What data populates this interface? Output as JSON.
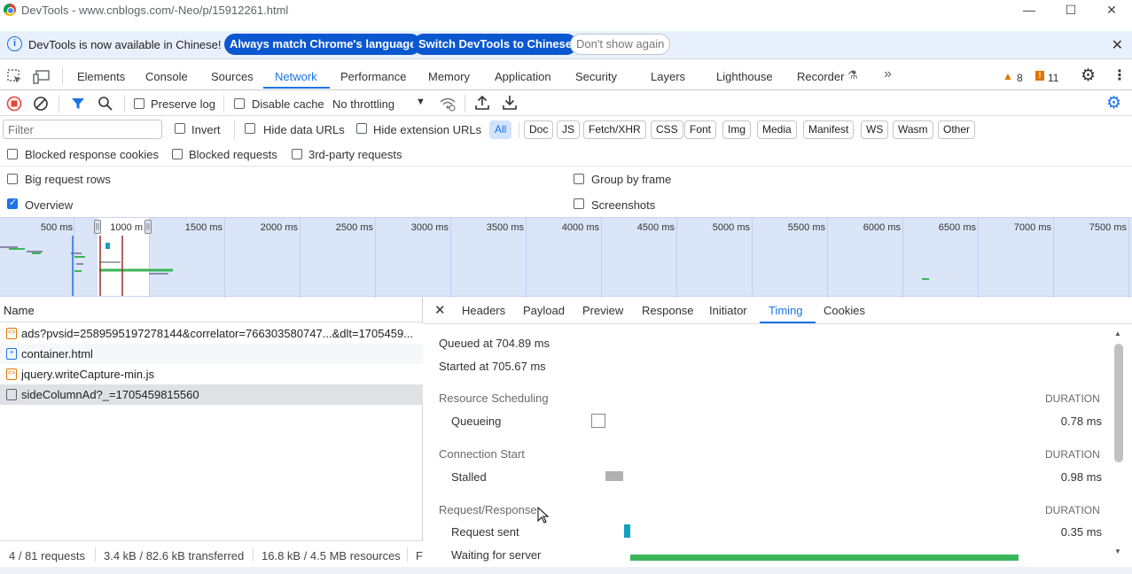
{
  "window": {
    "title": "DevTools - www.cnblogs.com/-Neo/p/15912261.html",
    "minimize": "—",
    "maximize": "☐",
    "close": "✕"
  },
  "infobar": {
    "message": "DevTools is now available in Chinese!",
    "btn_match": "Always match Chrome's language",
    "btn_switch": "Switch DevTools to Chinese",
    "btn_dismiss": "Don't show again",
    "close": "✕"
  },
  "main_tabs": [
    "Elements",
    "Console",
    "Sources",
    "Network",
    "Performance",
    "Memory",
    "Application",
    "Security",
    "Layers",
    "Lighthouse",
    "Recorder"
  ],
  "active_tab": "Network",
  "badges": {
    "warnings": "8",
    "issues": "11"
  },
  "toolbar": {
    "preserve_log": "Preserve log",
    "disable_cache": "Disable cache",
    "throttling": "No throttling"
  },
  "filter": {
    "placeholder": "Filter",
    "invert": "Invert",
    "hide_data_urls": "Hide data URLs",
    "hide_extension_urls": "Hide extension URLs",
    "chips": [
      "All",
      "Doc",
      "JS",
      "Fetch/XHR",
      "CSS",
      "Font",
      "Img",
      "Media",
      "Manifest",
      "WS",
      "Wasm",
      "Other"
    ]
  },
  "options": {
    "blocked_cookies": "Blocked response cookies",
    "blocked_requests": "Blocked requests",
    "third_party": "3rd-party requests",
    "big_rows": "Big request rows",
    "group_by_frame": "Group by frame",
    "overview": "Overview",
    "screenshots": "Screenshots",
    "overview_checked": true
  },
  "overview": {
    "ticks": [
      "500 ms",
      "1000 m",
      "1500 ms",
      "2000 ms",
      "2500 ms",
      "3000 ms",
      "3500 ms",
      "4000 ms",
      "4500 ms",
      "5000 ms",
      "5500 ms",
      "6000 ms",
      "6500 ms",
      "7000 ms",
      "7500 ms"
    ]
  },
  "requests": {
    "column_name": "Name",
    "rows": [
      {
        "icon": "script",
        "name": "ads?pvsid=2589595197278144&correlator=766303580747...&dlt=1705459..."
      },
      {
        "icon": "doc",
        "name": "container.html"
      },
      {
        "icon": "script",
        "name": "jquery.writeCapture-min.js"
      },
      {
        "icon": "other",
        "name": "sideColumnAd?_=1705459815560"
      }
    ],
    "status": {
      "requests": "4 / 81 requests",
      "transferred": "3.4 kB / 82.6 kB transferred",
      "resources": "16.8 kB / 4.5 MB resources",
      "extra": "F"
    }
  },
  "detail": {
    "close": "✕",
    "tabs": [
      "Headers",
      "Payload",
      "Preview",
      "Response",
      "Initiator",
      "Timing",
      "Cookies"
    ],
    "active_tab": "Timing",
    "queued": "Queued at 704.89 ms",
    "started": "Started at 705.67 ms",
    "duration_label": "DURATION",
    "sections": [
      {
        "title": "Resource Scheduling",
        "items": [
          {
            "label": "Queueing",
            "value": "0.78 ms"
          }
        ]
      },
      {
        "title": "Connection Start",
        "items": [
          {
            "label": "Stalled",
            "value": "0.98 ms"
          }
        ]
      },
      {
        "title": "Request/Response",
        "items": [
          {
            "label": "Request sent",
            "value": "0.35 ms"
          },
          {
            "label": "Waiting for server",
            "value": ""
          }
        ]
      }
    ],
    "colors": {
      "stalled": "#b1b1b1",
      "request_sent": "#12a2c0",
      "waiting": "#3ab65a"
    }
  }
}
